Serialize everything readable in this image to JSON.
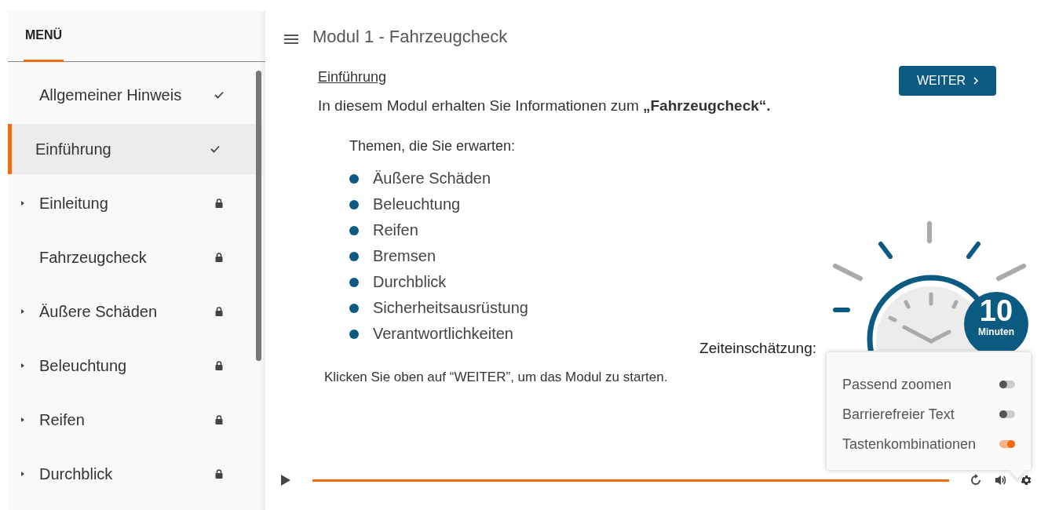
{
  "sidebar": {
    "title": "MENÜ",
    "items": [
      {
        "label": "Allgemeiner Hinweis",
        "completed": true,
        "has_children": false,
        "selected": false
      },
      {
        "label": "Einführung",
        "completed": true,
        "has_children": false,
        "selected": true
      },
      {
        "label": "Einleitung",
        "completed": false,
        "has_children": true,
        "selected": false
      },
      {
        "label": "Fahrzeugcheck",
        "completed": false,
        "has_children": false,
        "selected": false
      },
      {
        "label": "Äußere Schäden",
        "completed": false,
        "has_children": true,
        "selected": false
      },
      {
        "label": "Beleuchtung",
        "completed": false,
        "has_children": true,
        "selected": false
      },
      {
        "label": "Reifen",
        "completed": false,
        "has_children": true,
        "selected": false
      },
      {
        "label": "Durchblick",
        "completed": false,
        "has_children": true,
        "selected": false
      }
    ]
  },
  "header": {
    "title": "Modul 1 - Fahrzeugcheck"
  },
  "slide": {
    "heading": "Einführung",
    "next_button": "WEITER",
    "intro": "In diesem Modul erhalten Sie Informationen zum **„Fahrzeugcheck“.**",
    "topics_label": "Themen, die Sie erwarten:",
    "topics": [
      "Äußere Schäden",
      "Beleuchtung",
      "Reifen",
      "Bremsen",
      "Durchblick",
      "Sicherheitsausrüstung",
      "Verantwortlichkeiten"
    ],
    "time_label": "Zeiteinschätzung:",
    "time_value": "10",
    "time_unit": "Minuten",
    "hint": "Klicken Sie oben auf “WEITER”, um das Modul zu starten."
  },
  "settings_menu": {
    "options": [
      {
        "label": "Passend zoomen",
        "on": false
      },
      {
        "label": "Barrierefreier Text",
        "on": false
      },
      {
        "label": "Tastenkombinationen",
        "on": true
      }
    ]
  }
}
